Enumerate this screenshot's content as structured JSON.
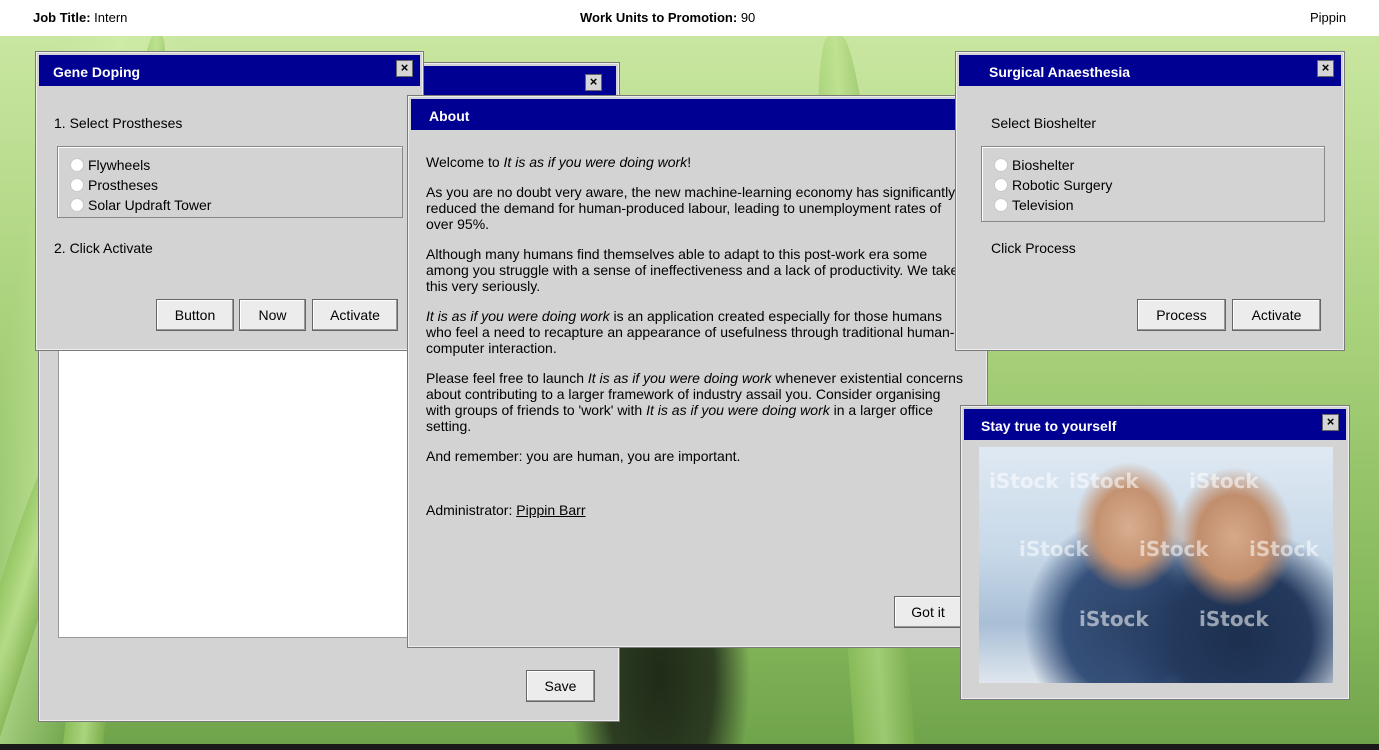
{
  "topbar": {
    "job_title_label": "Job Title:",
    "job_title_value": "Intern",
    "work_units_label": "Work Units to Promotion:",
    "work_units_value": "90",
    "username": "Pippin"
  },
  "gene_doping": {
    "title": "Gene Doping",
    "close": "×",
    "step1": "1. Select Prostheses",
    "options": [
      "Flywheels",
      "Prostheses",
      "Solar Updraft Tower"
    ],
    "step2": "2. Click Activate",
    "buttons": [
      "Button",
      "Now",
      "Activate"
    ]
  },
  "back_window": {
    "close": "×",
    "save_label": "Save"
  },
  "about": {
    "title": "About",
    "welcome_prefix": "Welcome to ",
    "app_name": "It is as if you were doing work",
    "welcome_suffix": "!",
    "para1": "As you are no doubt very aware, the new machine-learning economy has significantly reduced the demand for human-produced labour, leading to unemployment rates of over 95%.",
    "para2": "Although many humans find themselves able to adapt to this post-work era some among you struggle with a sense of ineffectiveness and a lack of productivity. We take this very seriously.",
    "para3_suffix": " is an application created especially for those humans who feel a need to recapture an appearance of usefulness through traditional human-computer interaction.",
    "para4_prefix": "Please feel free to launch ",
    "para4_middle": " whenever existential concerns about contributing to a larger framework of industry assail you. Consider organising with groups of friends to 'work' with ",
    "para4_suffix": " in a larger office setting.",
    "para5": "And remember: you are human, you are important.",
    "admin_label": "Administrator: ",
    "admin_name": "Pippin Barr",
    "gotit_label": "Got it"
  },
  "surgical": {
    "title": "Surgical Anaesthesia",
    "close": "×",
    "step1": "Select Bioshelter",
    "options": [
      "Bioshelter",
      "Robotic Surgery",
      "Television"
    ],
    "step2": "Click Process",
    "buttons": [
      "Process",
      "Activate"
    ]
  },
  "stay_true": {
    "title": "Stay true to yourself",
    "close": "×",
    "watermark": "iStock"
  },
  "colors": {
    "titlebar": "#000093",
    "window": "#d3d3d3"
  }
}
